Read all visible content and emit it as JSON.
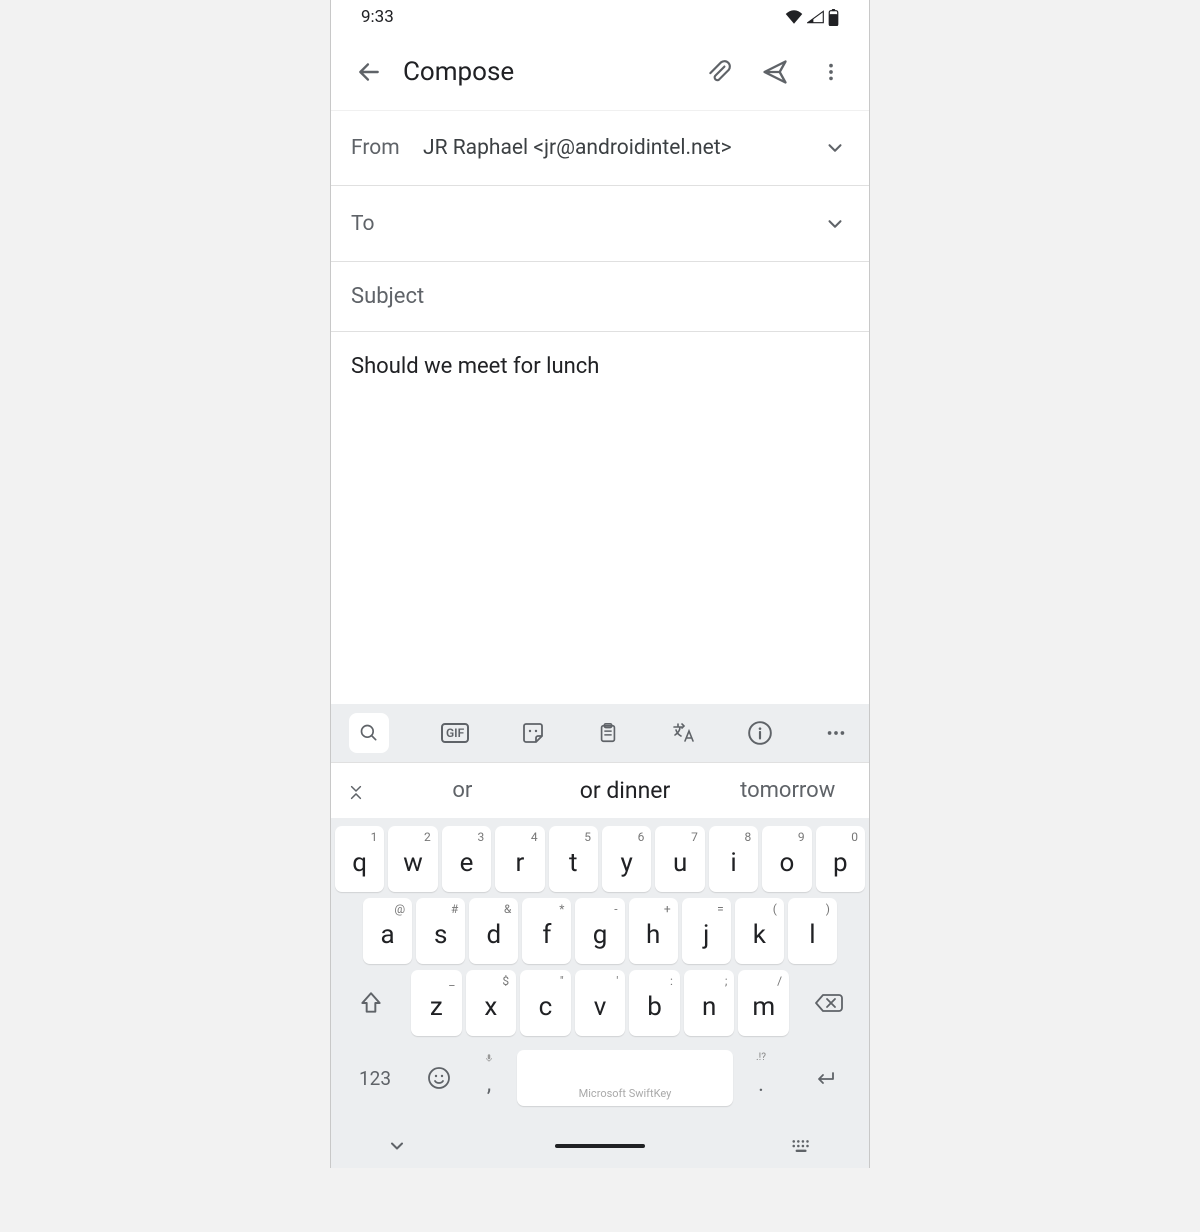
{
  "status": {
    "time": "9:33"
  },
  "appbar": {
    "title": "Compose"
  },
  "fields": {
    "from_label": "From",
    "from_value": "JR Raphael  <jr@androidintel.net>",
    "to_label": "To",
    "to_value": "",
    "subject_placeholder": "Subject"
  },
  "body": {
    "text": "Should we meet for lunch"
  },
  "keyboard": {
    "suggestions": [
      "or",
      "or dinner",
      "tomorrow"
    ],
    "row1": [
      {
        "l": "q",
        "h": "1"
      },
      {
        "l": "w",
        "h": "2"
      },
      {
        "l": "e",
        "h": "3"
      },
      {
        "l": "r",
        "h": "4"
      },
      {
        "l": "t",
        "h": "5"
      },
      {
        "l": "y",
        "h": "6"
      },
      {
        "l": "u",
        "h": "7"
      },
      {
        "l": "i",
        "h": "8"
      },
      {
        "l": "o",
        "h": "9"
      },
      {
        "l": "p",
        "h": "0"
      }
    ],
    "row2": [
      {
        "l": "a",
        "h": "@"
      },
      {
        "l": "s",
        "h": "#"
      },
      {
        "l": "d",
        "h": "&"
      },
      {
        "l": "f",
        "h": "*"
      },
      {
        "l": "g",
        "h": "-"
      },
      {
        "l": "h",
        "h": "+"
      },
      {
        "l": "j",
        "h": "="
      },
      {
        "l": "k",
        "h": "("
      },
      {
        "l": "l",
        "h": ")"
      }
    ],
    "row3": [
      {
        "l": "z",
        "h": "_"
      },
      {
        "l": "x",
        "h": "$"
      },
      {
        "l": "c",
        "h": "\""
      },
      {
        "l": "v",
        "h": "'"
      },
      {
        "l": "b",
        "h": ":"
      },
      {
        "l": "n",
        "h": ";"
      },
      {
        "l": "m",
        "h": "/"
      }
    ],
    "numeric_label": "123",
    "comma_hint": "🎤",
    "comma": ",",
    "period": ".",
    "period_hint": ".!?",
    "space_label": "Microsoft SwiftKey",
    "gif_label": "GIF"
  }
}
